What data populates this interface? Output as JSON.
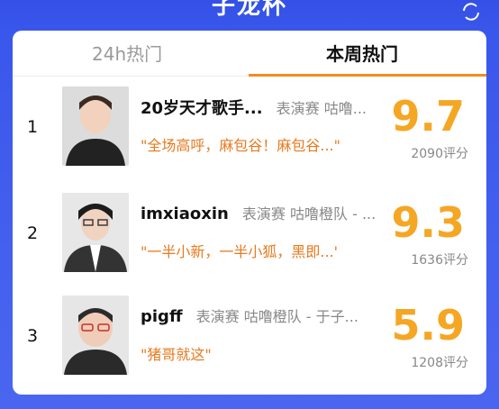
{
  "header": {
    "title": "子龙杯"
  },
  "tabs": [
    {
      "label": "24h热门"
    },
    {
      "label": "本周热门"
    }
  ],
  "active_tab": "本周热门",
  "rows": [
    {
      "rank": "1",
      "name": "20岁天才歌手...",
      "tag": "表演赛 咕噜...",
      "quote": "\"全场高呼，麻包谷！麻包谷...\"",
      "score": "9.7",
      "votes": "2090评分"
    },
    {
      "rank": "2",
      "name": "imxiaoxin",
      "tag": "表演赛 咕噜橙队 - ...",
      "quote": "\"一半小新，一半小狐，黑即...'",
      "score": "9.3",
      "votes": "1636评分"
    },
    {
      "rank": "3",
      "name": "pigff",
      "tag": "表演赛 咕噜橙队 - 于子...",
      "quote": "\"猪哥就这\"",
      "score": "5.9",
      "votes": "1208评分"
    }
  ],
  "colors": {
    "accent": "#f58a1f",
    "score": "#f5a623",
    "quote": "#e87a1e",
    "background": "#3a57ec"
  },
  "icons": {
    "refresh": "refresh-icon"
  }
}
